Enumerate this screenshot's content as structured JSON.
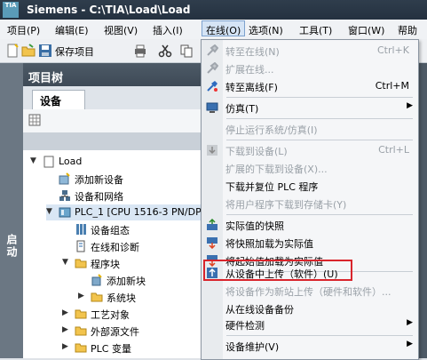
{
  "window": {
    "logo": "TIA",
    "title": "Siemens  -  C:\\TIA\\Load\\Load"
  },
  "menubar": {
    "items": [
      "项目(P)",
      "编辑(E)",
      "视图(V)",
      "插入(I)",
      "在线(O)",
      "选项(N)",
      "工具(T)",
      "窗口(W)",
      "帮助"
    ]
  },
  "toolbar": {
    "save_label": "保存项目"
  },
  "sidebar": {
    "label": "启动"
  },
  "project_tree": {
    "title": "项目树",
    "tab": "设备",
    "items": [
      {
        "label": "Load",
        "icon": "project-icon"
      },
      {
        "label": "添加新设备",
        "icon": "add-device-icon"
      },
      {
        "label": "设备和网络",
        "icon": "network-icon"
      },
      {
        "label": "PLC_1 [CPU 1516-3 PN/DP]",
        "icon": "plc-icon"
      },
      {
        "label": "设备组态",
        "icon": "device-config-icon"
      },
      {
        "label": "在线和诊断",
        "icon": "diagnostics-icon"
      },
      {
        "label": "程序块",
        "icon": "folder-icon"
      },
      {
        "label": "添加新块",
        "icon": "add-block-icon"
      },
      {
        "label": "系统块",
        "icon": "folder-icon"
      },
      {
        "label": "工艺对象",
        "icon": "folder-icon"
      },
      {
        "label": "外部源文件",
        "icon": "folder-icon"
      },
      {
        "label": "PLC 变量",
        "icon": "folder-icon"
      }
    ]
  },
  "online_menu": {
    "items": [
      {
        "label": "转至在线(N)",
        "shortcut": "Ctrl+K",
        "disabled": true,
        "icon": "go-online-icon"
      },
      {
        "label": "扩展在线...",
        "shortcut": "",
        "disabled": true,
        "icon": "extend-online-icon"
      },
      {
        "label": "转至离线(F)",
        "shortcut": "Ctrl+M",
        "disabled": false,
        "icon": "go-offline-icon"
      },
      {
        "label": "仿真(T)",
        "shortcut": "",
        "disabled": false,
        "icon": "simulation-icon",
        "submenu": true
      },
      {
        "label": "停止运行系统/仿真(I)",
        "shortcut": "",
        "disabled": true,
        "icon": ""
      },
      {
        "label": "下载到设备(L)",
        "shortcut": "Ctrl+L",
        "disabled": true,
        "icon": "download-icon"
      },
      {
        "label": "扩展的下载到设备(X)...",
        "shortcut": "",
        "disabled": true,
        "icon": ""
      },
      {
        "label": "下载并复位 PLC 程序",
        "shortcut": "",
        "disabled": false,
        "icon": ""
      },
      {
        "label": "将用户程序下载到存储卡(Y)",
        "shortcut": "",
        "disabled": true,
        "icon": ""
      },
      {
        "label": "实际值的快照",
        "shortcut": "",
        "disabled": false,
        "icon": "snapshot-icon"
      },
      {
        "label": "将快照加载为实际值",
        "shortcut": "",
        "disabled": false,
        "icon": "load-snapshot-icon"
      },
      {
        "label": "将起始值加载为实际值",
        "shortcut": "",
        "disabled": false,
        "icon": "load-start-values-icon"
      },
      {
        "label": "从设备中上传（软件）(U)",
        "shortcut": "",
        "disabled": false,
        "icon": "upload-icon"
      },
      {
        "label": "将设备作为新站上传（硬件和软件）...",
        "shortcut": "",
        "disabled": true,
        "icon": ""
      },
      {
        "label": "从在线设备备份",
        "shortcut": "",
        "disabled": false,
        "icon": ""
      },
      {
        "label": "硬件检测",
        "shortcut": "",
        "disabled": false,
        "icon": "",
        "submenu": true
      },
      {
        "label": "设备维护(V)",
        "shortcut": "",
        "disabled": false,
        "icon": "",
        "submenu": true
      }
    ]
  },
  "colors": {
    "highlight": "#d9252c",
    "menu_bg": "#f5f6f8",
    "title_bg": "#2f3d4c"
  }
}
